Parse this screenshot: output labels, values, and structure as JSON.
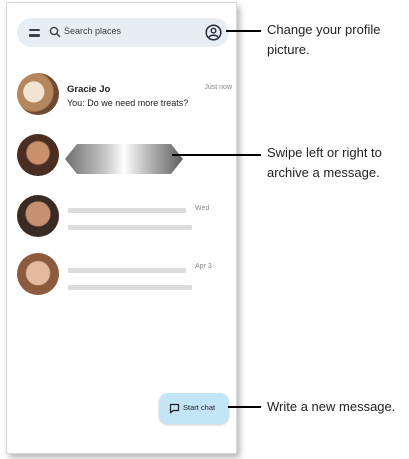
{
  "search": {
    "menu_icon": "menu-icon",
    "search_icon": "search-icon",
    "placeholder": "Search places",
    "profile_icon": "account-circle-icon"
  },
  "conversations": [
    {
      "name": "Gracie Jo",
      "message": "You: Do we need more treats?",
      "time": "Just now"
    },
    {
      "name": "",
      "message": "",
      "time": ""
    },
    {
      "name": "",
      "message": "",
      "time": "Wed"
    },
    {
      "name": "",
      "message": "",
      "time": "Apr 3"
    }
  ],
  "fab": {
    "icon": "chat-bubble-icon",
    "label": "Start chat",
    "color": "#c3e6f7"
  },
  "callouts": [
    {
      "text": "Change your profile picture."
    },
    {
      "text": "Swipe left or right to archive a message."
    },
    {
      "text": "Write a new message."
    }
  ],
  "colors": {
    "search_bar": "#e8edf4",
    "placeholder_lines": "#dcdcdc"
  }
}
